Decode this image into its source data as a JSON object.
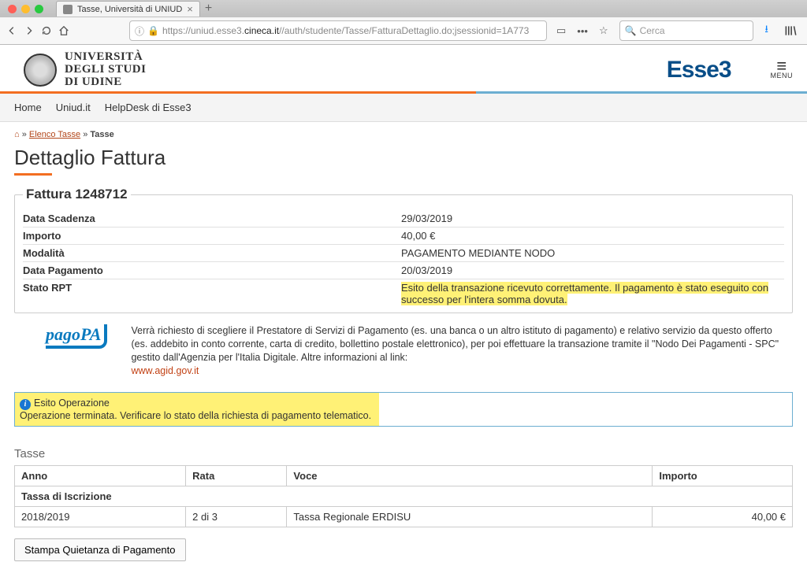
{
  "browser": {
    "tab_title": "Tasse, Università di UNIUD",
    "url_prefix": "https://uniud.esse3.",
    "url_host": "cineca.it",
    "url_path": "//auth/studente/Tasse/FatturaDettaglio.do;jsessionid=1A773",
    "search_placeholder": "Cerca"
  },
  "header": {
    "uni_line1": "UNIVERSITÀ",
    "uni_line2": "DEGLI STUDI",
    "uni_line3": "DI UDINE",
    "brand": "Esse3",
    "menu_label": "MENU"
  },
  "nav": {
    "items": [
      "Home",
      "Uniud.it",
      "HelpDesk di Esse3"
    ]
  },
  "breadcrumb": {
    "elenco": "Elenco Tasse",
    "sep": " » ",
    "current": "Tasse"
  },
  "page": {
    "title": "Dettaglio Fattura"
  },
  "fattura": {
    "legend": "Fattura 1248712",
    "rows": [
      {
        "label": "Data Scadenza",
        "value": "29/03/2019",
        "hl": false
      },
      {
        "label": "Importo",
        "value": "40,00 €",
        "hl": false
      },
      {
        "label": "Modalità",
        "value": "PAGAMENTO MEDIANTE NODO",
        "hl": false
      },
      {
        "label": "Data Pagamento",
        "value": "20/03/2019",
        "hl": false
      },
      {
        "label": "Stato RPT",
        "value": "Esito della transazione ricevuto correttamente. Il pagamento è stato eseguito con successo per l'intera somma dovuta.",
        "hl": true
      }
    ]
  },
  "pago": {
    "logo_text": "pagoPA",
    "description": "Verrà richiesto di scegliere il Prestatore di Servizi di Pagamento (es. una banca o un altro istituto di pagamento) e relativo servizio da questo offerto (es. addebito in conto corrente, carta di credito, bollettino postale elettronico), per poi effettuare la transazione tramite il \"Nodo Dei Pagamenti - SPC\" gestito dall'Agenzia per l'Italia Digitale. Altre informazioni al link:",
    "link_text": "www.agid.gov.it"
  },
  "esito": {
    "title": "Esito Operazione",
    "message": "Operazione terminata. Verificare lo stato della richiesta di pagamento telematico."
  },
  "tasse": {
    "section_title": "Tasse",
    "headers": {
      "anno": "Anno",
      "rata": "Rata",
      "voce": "Voce",
      "importo": "Importo"
    },
    "subheader": "Tassa di Iscrizione",
    "row": {
      "anno": "2018/2019",
      "rata": "2 di 3",
      "voce": "Tassa Regionale ERDISU",
      "importo": "40,00 €"
    }
  },
  "buttons": {
    "print": "Stampa Quietanza di Pagamento"
  }
}
